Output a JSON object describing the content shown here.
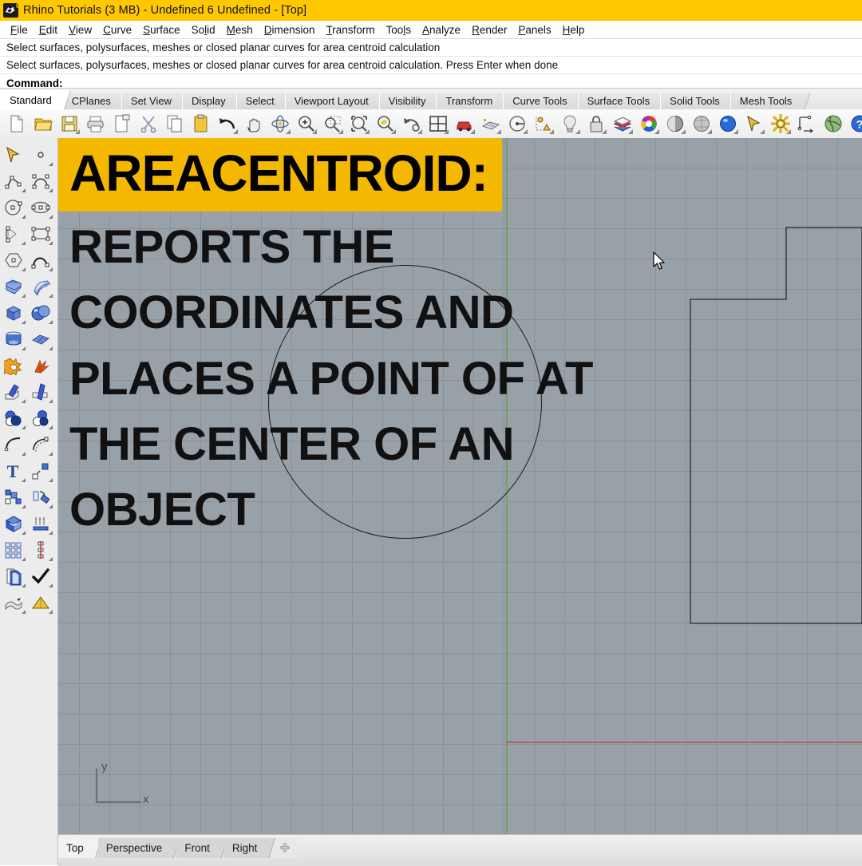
{
  "window": {
    "title": "Rhino Tutorials (3 MB) - Undefined 6 Undefined - [Top]",
    "icon": "rhino-logo-icon",
    "titlebar_color": "#FFC800"
  },
  "menubar": {
    "items": [
      {
        "label": "File",
        "accel": "F"
      },
      {
        "label": "Edit",
        "accel": "E"
      },
      {
        "label": "View",
        "accel": "V"
      },
      {
        "label": "Curve",
        "accel": "C"
      },
      {
        "label": "Surface",
        "accel": "S"
      },
      {
        "label": "Solid",
        "accel": "l"
      },
      {
        "label": "Mesh",
        "accel": "M"
      },
      {
        "label": "Dimension",
        "accel": "D"
      },
      {
        "label": "Transform",
        "accel": "T"
      },
      {
        "label": "Tools",
        "accel": "l"
      },
      {
        "label": "Analyze",
        "accel": "A"
      },
      {
        "label": "Render",
        "accel": "R"
      },
      {
        "label": "Panels",
        "accel": "P"
      },
      {
        "label": "Help",
        "accel": "H"
      }
    ]
  },
  "command_area": {
    "history": [
      "Select surfaces, polysurfaces, meshes or closed planar curves for area centroid calculation",
      "Select surfaces, polysurfaces, meshes or closed planar curves for area centroid calculation. Press Enter when done"
    ],
    "prompt_label": "Command:",
    "prompt_value": ""
  },
  "tabstrip": {
    "active": "Standard",
    "tabs": [
      {
        "label": "Standard"
      },
      {
        "label": "CPlanes"
      },
      {
        "label": "Set View"
      },
      {
        "label": "Display"
      },
      {
        "label": "Select"
      },
      {
        "label": "Viewport Layout"
      },
      {
        "label": "Visibility"
      },
      {
        "label": "Transform"
      },
      {
        "label": "Curve Tools"
      },
      {
        "label": "Surface Tools"
      },
      {
        "label": "Solid Tools"
      },
      {
        "label": "Mesh Tools"
      }
    ]
  },
  "toolbar": {
    "buttons": [
      {
        "icon": "new-file-icon",
        "flyout": false
      },
      {
        "icon": "open-folder-icon",
        "flyout": false
      },
      {
        "icon": "save-icon",
        "flyout": true
      },
      {
        "icon": "print-icon",
        "flyout": false
      },
      {
        "icon": "copy-to-clipboard-icon",
        "flyout": false
      },
      {
        "icon": "cut-scissors-icon",
        "flyout": false
      },
      {
        "icon": "copy-icon",
        "flyout": false
      },
      {
        "icon": "paste-icon",
        "flyout": false
      },
      {
        "icon": "undo-icon",
        "flyout": true
      },
      {
        "icon": "pan-hand-icon",
        "flyout": false
      },
      {
        "icon": "rotate-view-icon",
        "flyout": true
      },
      {
        "icon": "zoom-in-icon",
        "flyout": true
      },
      {
        "icon": "zoom-window-icon",
        "flyout": true
      },
      {
        "icon": "zoom-extents-icon",
        "flyout": true
      },
      {
        "icon": "zoom-selected-icon",
        "flyout": true
      },
      {
        "icon": "zoom-previous-icon",
        "flyout": true
      },
      {
        "icon": "viewport-layout-icon",
        "flyout": true
      },
      {
        "icon": "render-car-icon",
        "flyout": true
      },
      {
        "icon": "mesh-grid-icon",
        "flyout": true
      },
      {
        "icon": "gumball-icon",
        "flyout": true
      },
      {
        "icon": "object-snap-icon",
        "flyout": true
      },
      {
        "icon": "light-bulb-icon",
        "flyout": true
      },
      {
        "icon": "lock-icon",
        "flyout": true
      },
      {
        "icon": "layers-icon",
        "flyout": true
      },
      {
        "icon": "color-wheel-icon",
        "flyout": true
      },
      {
        "icon": "shaded-sphere-icon",
        "flyout": true
      },
      {
        "icon": "ghosted-sphere-icon",
        "flyout": true
      },
      {
        "icon": "rendered-sphere-icon",
        "flyout": true
      },
      {
        "icon": "select-arrow-icon",
        "flyout": true
      },
      {
        "icon": "options-gear-icon",
        "flyout": true
      },
      {
        "icon": "dimension-icon",
        "flyout": false
      },
      {
        "icon": "globe-icon",
        "flyout": false
      },
      {
        "icon": "help-icon",
        "flyout": false
      }
    ]
  },
  "sidebar": {
    "buttons": [
      {
        "icon": "select-arrow-icon",
        "flyout": false
      },
      {
        "icon": "point-icon",
        "flyout": true
      },
      {
        "icon": "polyline-icon",
        "flyout": true
      },
      {
        "icon": "curve-icon",
        "flyout": true
      },
      {
        "icon": "circle-icon",
        "flyout": true
      },
      {
        "icon": "ellipse-icon",
        "flyout": true
      },
      {
        "icon": "arc-icon",
        "flyout": true
      },
      {
        "icon": "rectangle-icon",
        "flyout": true
      },
      {
        "icon": "polygon-icon",
        "flyout": true
      },
      {
        "icon": "curve-from-objects-icon",
        "flyout": true
      },
      {
        "icon": "surface-from-curves-icon",
        "flyout": true
      },
      {
        "icon": "extrude-surface-icon",
        "flyout": true
      },
      {
        "icon": "box-icon",
        "flyout": true
      },
      {
        "icon": "sphere-icon",
        "flyout": true
      },
      {
        "icon": "cylinder-icon",
        "flyout": true
      },
      {
        "icon": "surface-grid-icon",
        "flyout": true
      },
      {
        "icon": "boolean-union-icon",
        "flyout": false
      },
      {
        "icon": "explode-icon",
        "flyout": false
      },
      {
        "icon": "trim-icon",
        "flyout": true
      },
      {
        "icon": "split-icon",
        "flyout": true
      },
      {
        "icon": "boolean-difference-icon",
        "flyout": true
      },
      {
        "icon": "boolean-intersection-icon",
        "flyout": true
      },
      {
        "icon": "fillet-icon",
        "flyout": true
      },
      {
        "icon": "offset-icon",
        "flyout": true
      },
      {
        "icon": "text-icon",
        "flyout": true
      },
      {
        "icon": "copy-object-icon",
        "flyout": true
      },
      {
        "icon": "group-icon",
        "flyout": true
      },
      {
        "icon": "rotate-object-icon",
        "flyout": true
      },
      {
        "icon": "box-edit-icon",
        "flyout": true
      },
      {
        "icon": "array-linear-icon",
        "flyout": true
      },
      {
        "icon": "array-grid-icon",
        "flyout": true
      },
      {
        "icon": "array-polar-icon",
        "flyout": true
      },
      {
        "icon": "layers-panel-icon",
        "flyout": true
      },
      {
        "icon": "checkmark-icon",
        "flyout": true
      },
      {
        "icon": "blend-surface-icon",
        "flyout": true
      },
      {
        "icon": "mesh-pyramid-icon",
        "flyout": true
      }
    ]
  },
  "viewport": {
    "name": "Top",
    "background_color": "#98A0A8",
    "grid_spacing_px": 38,
    "axis_x_color": "#B05D5D",
    "axis_y_color": "#6F9E63",
    "axis_indicator": {
      "x_label": "x",
      "y_label": "y"
    },
    "objects": [
      {
        "type": "circle",
        "name": "circle-curve"
      },
      {
        "type": "polyline",
        "name": "stepped-polyline-curve"
      }
    ],
    "cursor": {
      "type": "arrow-cursor"
    }
  },
  "overlay": {
    "banner": "AREACENTROID:",
    "banner_bg": "#F5B800",
    "body_lines": [
      "REPORTS THE",
      "COORDINATES AND",
      "PLACES A POINT OF AT",
      "THE CENTER OF AN",
      "OBJECT"
    ]
  },
  "viewport_tabs": {
    "active": "Top",
    "tabs": [
      {
        "label": "Top"
      },
      {
        "label": "Perspective"
      },
      {
        "label": "Front"
      },
      {
        "label": "Right"
      }
    ],
    "add_label": "+"
  }
}
